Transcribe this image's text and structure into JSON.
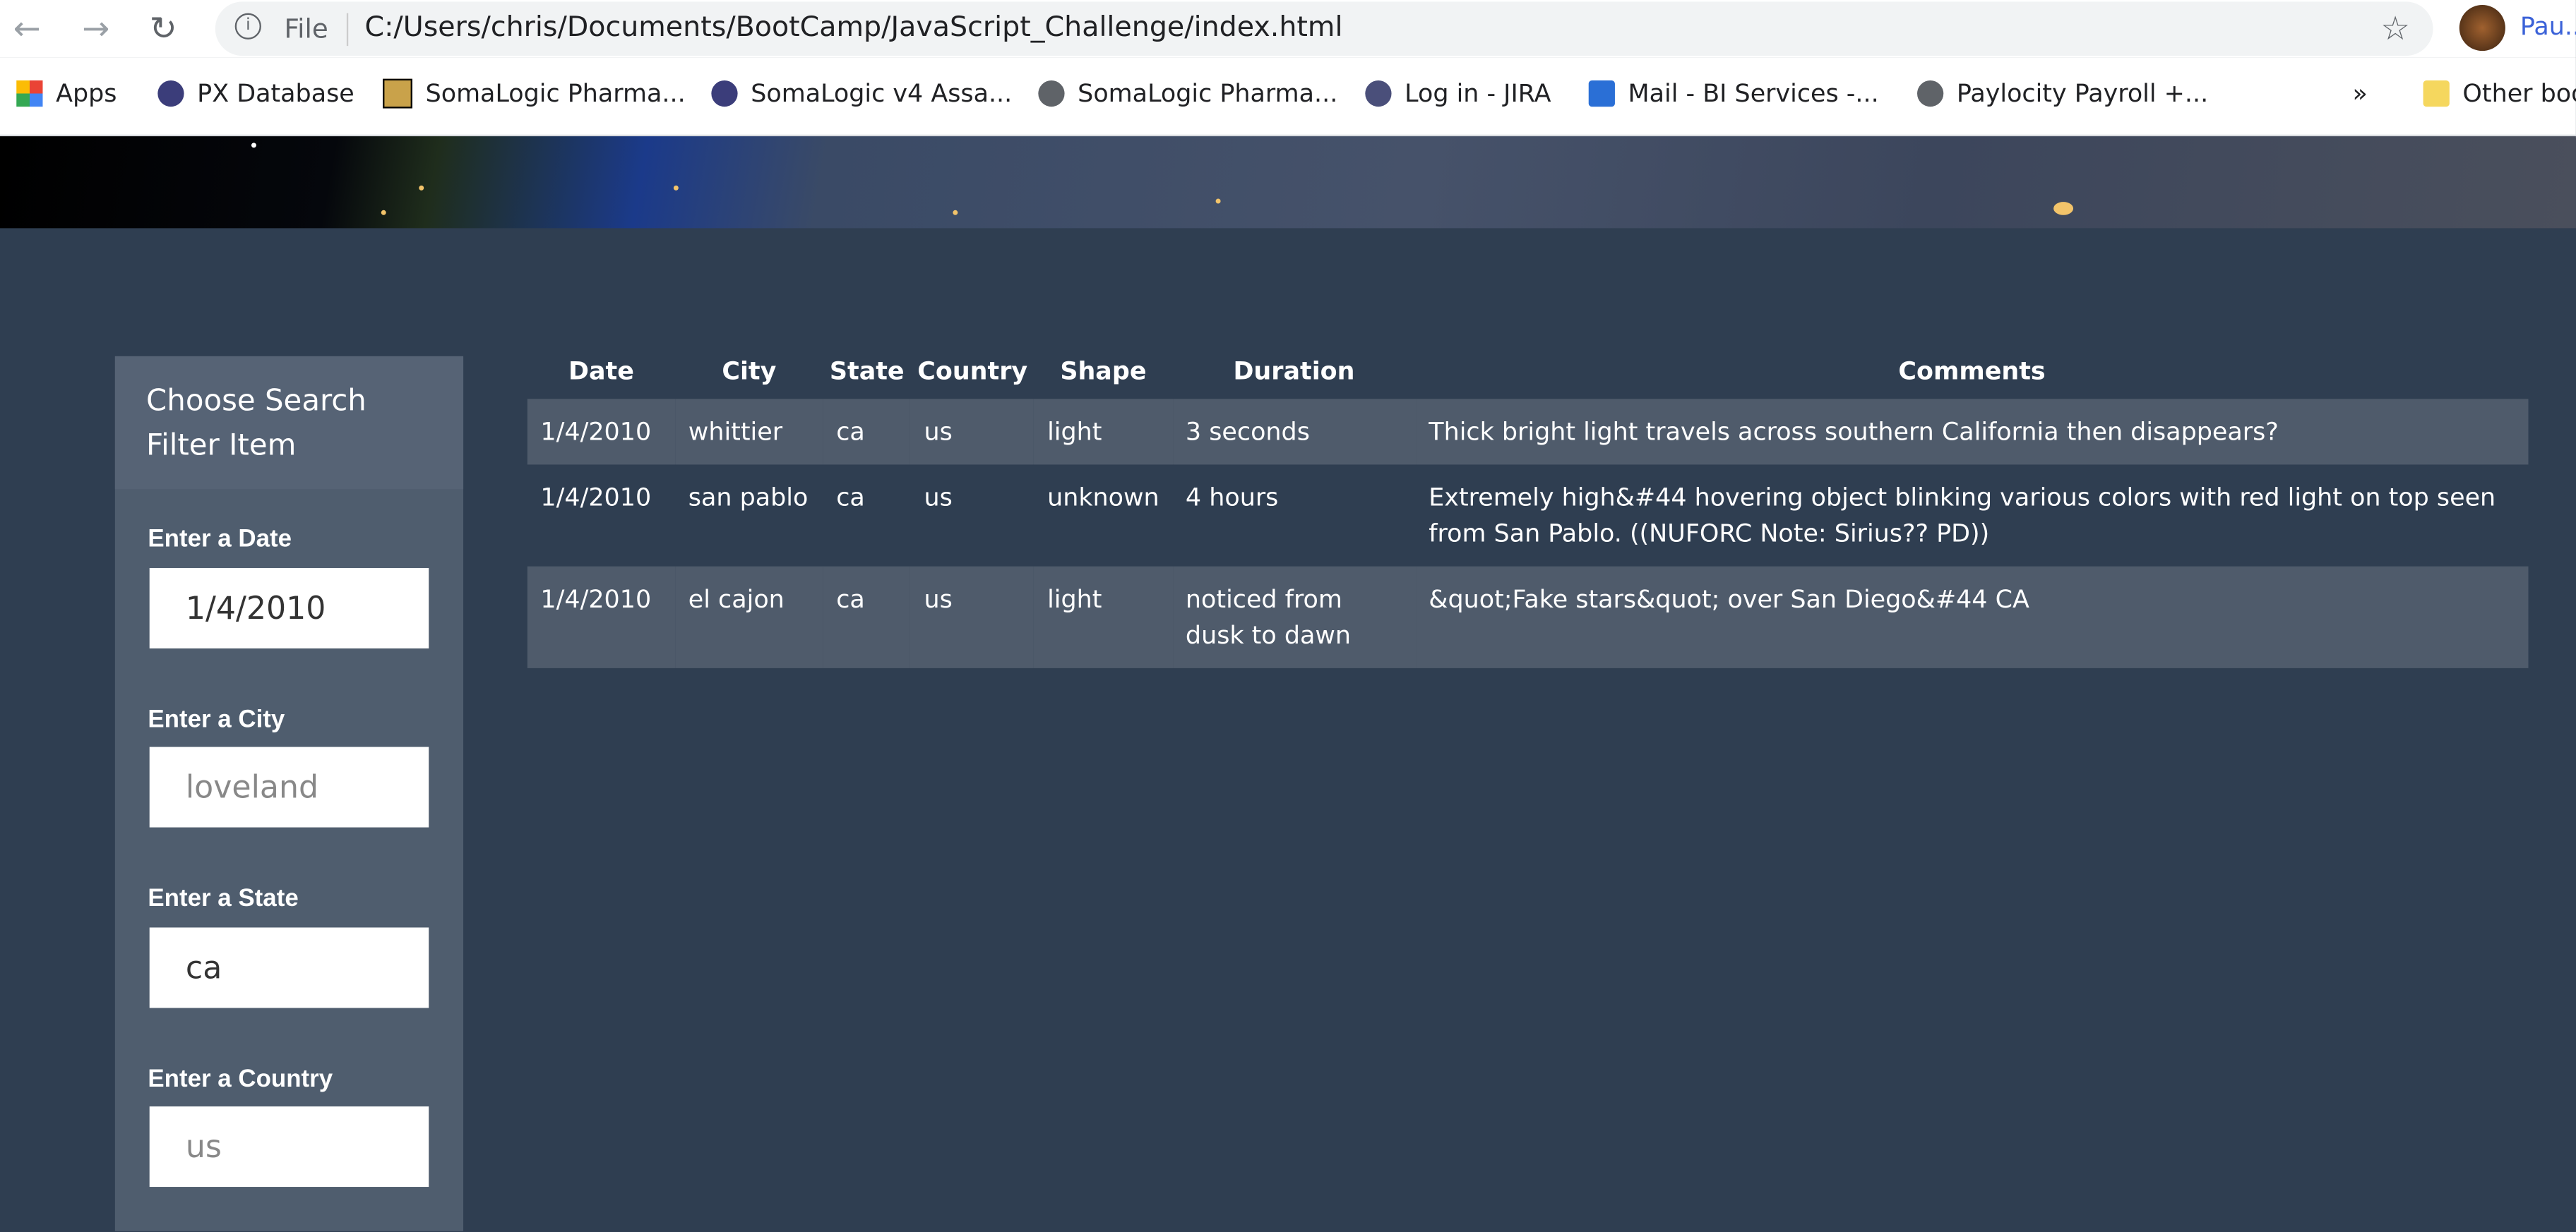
{
  "browser": {
    "url_scheme": "File",
    "url": "C:/Users/chris/Documents/BootCamp/JavaScript_Challenge/index.html",
    "profile": "Pau...",
    "bookmarks": [
      "Apps",
      "PX Database",
      "SomaLogic Pharma...",
      "SomaLogic v4 Assa...",
      "SomaLogic Pharma...",
      "Log in - JIRA",
      "Mail - BI Services -...",
      "Paylocity Payroll +..."
    ],
    "more": "»",
    "other": "Other boo"
  },
  "sidebar": {
    "title": "Choose Search Filter Item",
    "fields": [
      {
        "label": "Enter a Date",
        "value": "1/4/2010",
        "placeholder": ""
      },
      {
        "label": "Enter a City",
        "value": "",
        "placeholder": "loveland"
      },
      {
        "label": "Enter a State",
        "value": "ca",
        "placeholder": ""
      },
      {
        "label": "Enter a Country",
        "value": "",
        "placeholder": "us"
      }
    ]
  },
  "table": {
    "headers": [
      "Date",
      "City",
      "State",
      "Country",
      "Shape",
      "Duration",
      "Comments"
    ],
    "rows": [
      [
        "1/4/2010",
        "whittier",
        "ca",
        "us",
        "light",
        "3 seconds",
        "Thick bright light travels across southern California then disappears?"
      ],
      [
        "1/4/2010",
        "san pablo",
        "ca",
        "us",
        "unknown",
        "4 hours",
        "Extremely high&#44 hovering object blinking various colors with red light on top seen from San Pablo. ((NUFORC Note: Sirius?? PD))"
      ],
      [
        "1/4/2010",
        "el cajon",
        "ca",
        "us",
        "light",
        "noticed from dusk to dawn",
        "&quot;Fake stars&quot; over San Diego&#44 CA"
      ]
    ]
  }
}
